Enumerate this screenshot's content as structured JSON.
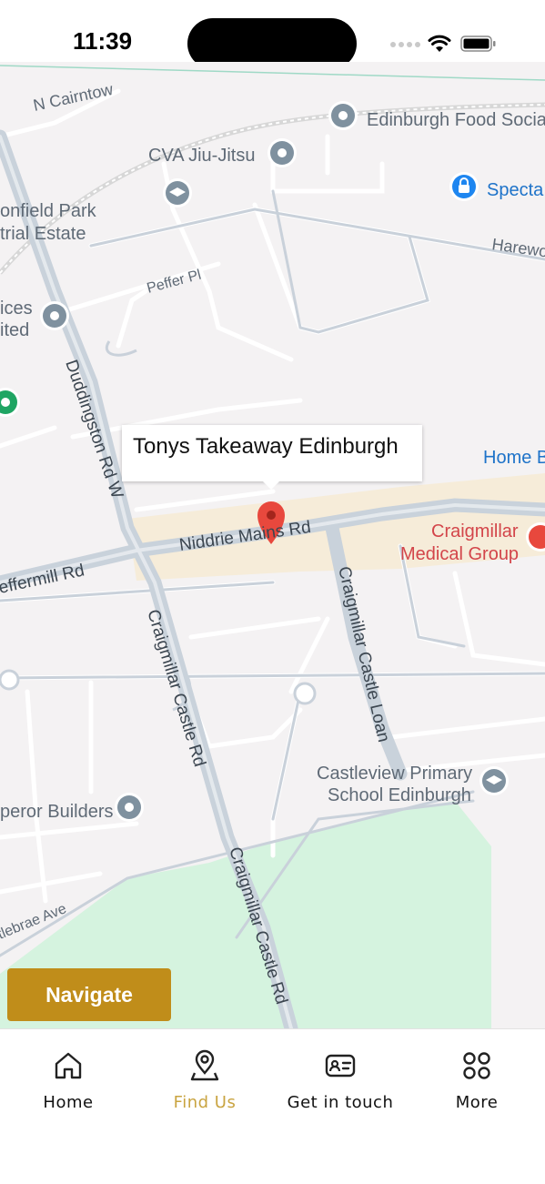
{
  "status_bar": {
    "time": "11:39"
  },
  "map": {
    "callout_title": "Tonys Takeaway Edinburgh",
    "labels": {
      "n_cairntow": "N Cairntow",
      "edinburgh_food_social": "Edinburgh Food Social",
      "cva_jiu_jitsu": "CVA Jiu-Jitsu",
      "specta": "Specta",
      "field_park_1": "onfield Park",
      "field_park_2": "trial Estate",
      "harewo": "Harewo",
      "peffer_pl": "Peffer Pl",
      "services_1": "ices",
      "services_2": "ited",
      "duddingston": "Duddingston Rd W",
      "home_b": "Home B",
      "craigmillar_medical_1": "Craigmillar",
      "craigmillar_medical_2": "Medical Group",
      "niddrie_mains": "Niddrie Mains Rd",
      "peffermill": "effermill Rd",
      "craigmillar_castle_loan": "Craigmillar Castle Loan",
      "craigmillar_castle_rd_1": "Craigmillar Castle Rd",
      "craigmillar_castle_rd_2": "Craigmillar Castle Rd",
      "castleview_1": "Castleview Primary",
      "castleview_2": "School Edinburgh",
      "emperor_builders": "peror Builders",
      "castlebrae": "tlebrae Ave"
    }
  },
  "navigate_button": {
    "label": "Navigate"
  },
  "tabs": [
    {
      "label": "Home",
      "icon": "home-icon"
    },
    {
      "label": "Find Us",
      "icon": "location-pin-icon",
      "active": true
    },
    {
      "label": "Get in touch",
      "icon": "contact-card-icon"
    },
    {
      "label": "More",
      "icon": "grid-icon"
    }
  ],
  "colors": {
    "accent": "#c08d1a",
    "active_tab": "#c9a441",
    "marker": "#e8483d",
    "park": "#d5f3df"
  }
}
